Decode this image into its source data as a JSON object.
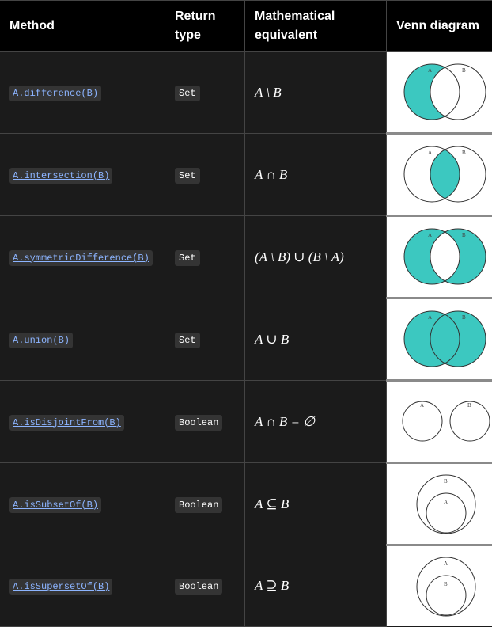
{
  "headers": {
    "method": "Method",
    "return_type": "Return type",
    "math": "Mathematical equivalent",
    "venn": "Venn diagram"
  },
  "rows": [
    {
      "method": "A.difference(B)",
      "type": "Set",
      "math": "A \\ B",
      "venn": "difference",
      "labels": {
        "a": "A",
        "b": "B"
      }
    },
    {
      "method": "A.intersection(B)",
      "type": "Set",
      "math": "A ∩ B",
      "venn": "intersection",
      "labels": {
        "a": "A",
        "b": "B"
      }
    },
    {
      "method": "A.symmetricDifference(B)",
      "type": "Set",
      "math": "(A \\ B) ∪ (B \\ A)",
      "venn": "symmetric-difference",
      "labels": {
        "a": "A",
        "b": "B"
      }
    },
    {
      "method": "A.union(B)",
      "type": "Set",
      "math": "A ∪ B",
      "venn": "union",
      "labels": {
        "a": "A",
        "b": "B"
      }
    },
    {
      "method": "A.isDisjointFrom(B)",
      "type": "Boolean",
      "math": "A ∩ B = ∅",
      "venn": "disjoint",
      "labels": {
        "a": "A",
        "b": "B"
      }
    },
    {
      "method": "A.isSubsetOf(B)",
      "type": "Boolean",
      "math": "A ⊆ B",
      "venn": "subset",
      "labels": {
        "outer": "B",
        "inner": "A"
      }
    },
    {
      "method": "A.isSupersetOf(B)",
      "type": "Boolean",
      "math": "A ⊇ B",
      "venn": "superset",
      "labels": {
        "outer": "A",
        "inner": "B"
      }
    }
  ],
  "colors": {
    "fill": "#3cc8c0",
    "stroke": "#333333"
  }
}
